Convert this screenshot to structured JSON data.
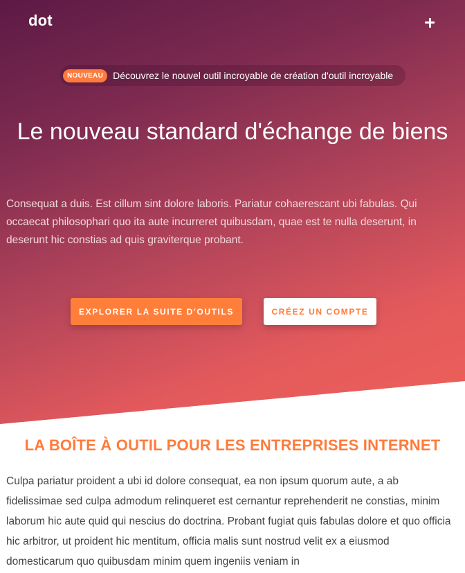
{
  "navbar": {
    "brand": "dot",
    "menu_icon": "plus-icon"
  },
  "announcement": {
    "badge": "NOUVEAU",
    "text": "Découvrez le nouvel outil incroyable de création d'outil incroyable"
  },
  "hero": {
    "title": "Le nouveau standard d'échange de biens",
    "lead": "Consequat a duis. Est cillum sint dolore laboris. Pariatur cohaerescant ubi fabulas. Qui occaecat philosophari quo ita aute incurreret quibusdam, quae est te nulla deserunt, in deserunt hic constias ad quis graviterque probant.",
    "primary_button": "Explorer la suite d'outils",
    "secondary_button": "Créez un compte"
  },
  "features": {
    "title": "LA BOÎTE À OUTIL POUR LES ENTREPRISES INTERNET",
    "text": "Culpa pariatur proident a ubi id dolore consequat, ea non ipsum quorum aute, a ab fidelissimae sed culpa admodum relinqueret est cernantur reprehenderit ne constias, minim laborum hic aute quid qui nescius do doctrina. Probant fugiat quis fabulas dolore et quo officia hic arbitror, ut proident hic mentitum, officia malis sunt nostrud velit ex a eiusmod domesticarum quo quibusdam minim quem ingeniis veniam in"
  },
  "colors": {
    "accent": "#ff7a3a",
    "hero_top": "#5c1a45",
    "hero_bottom": "#ee6159"
  }
}
